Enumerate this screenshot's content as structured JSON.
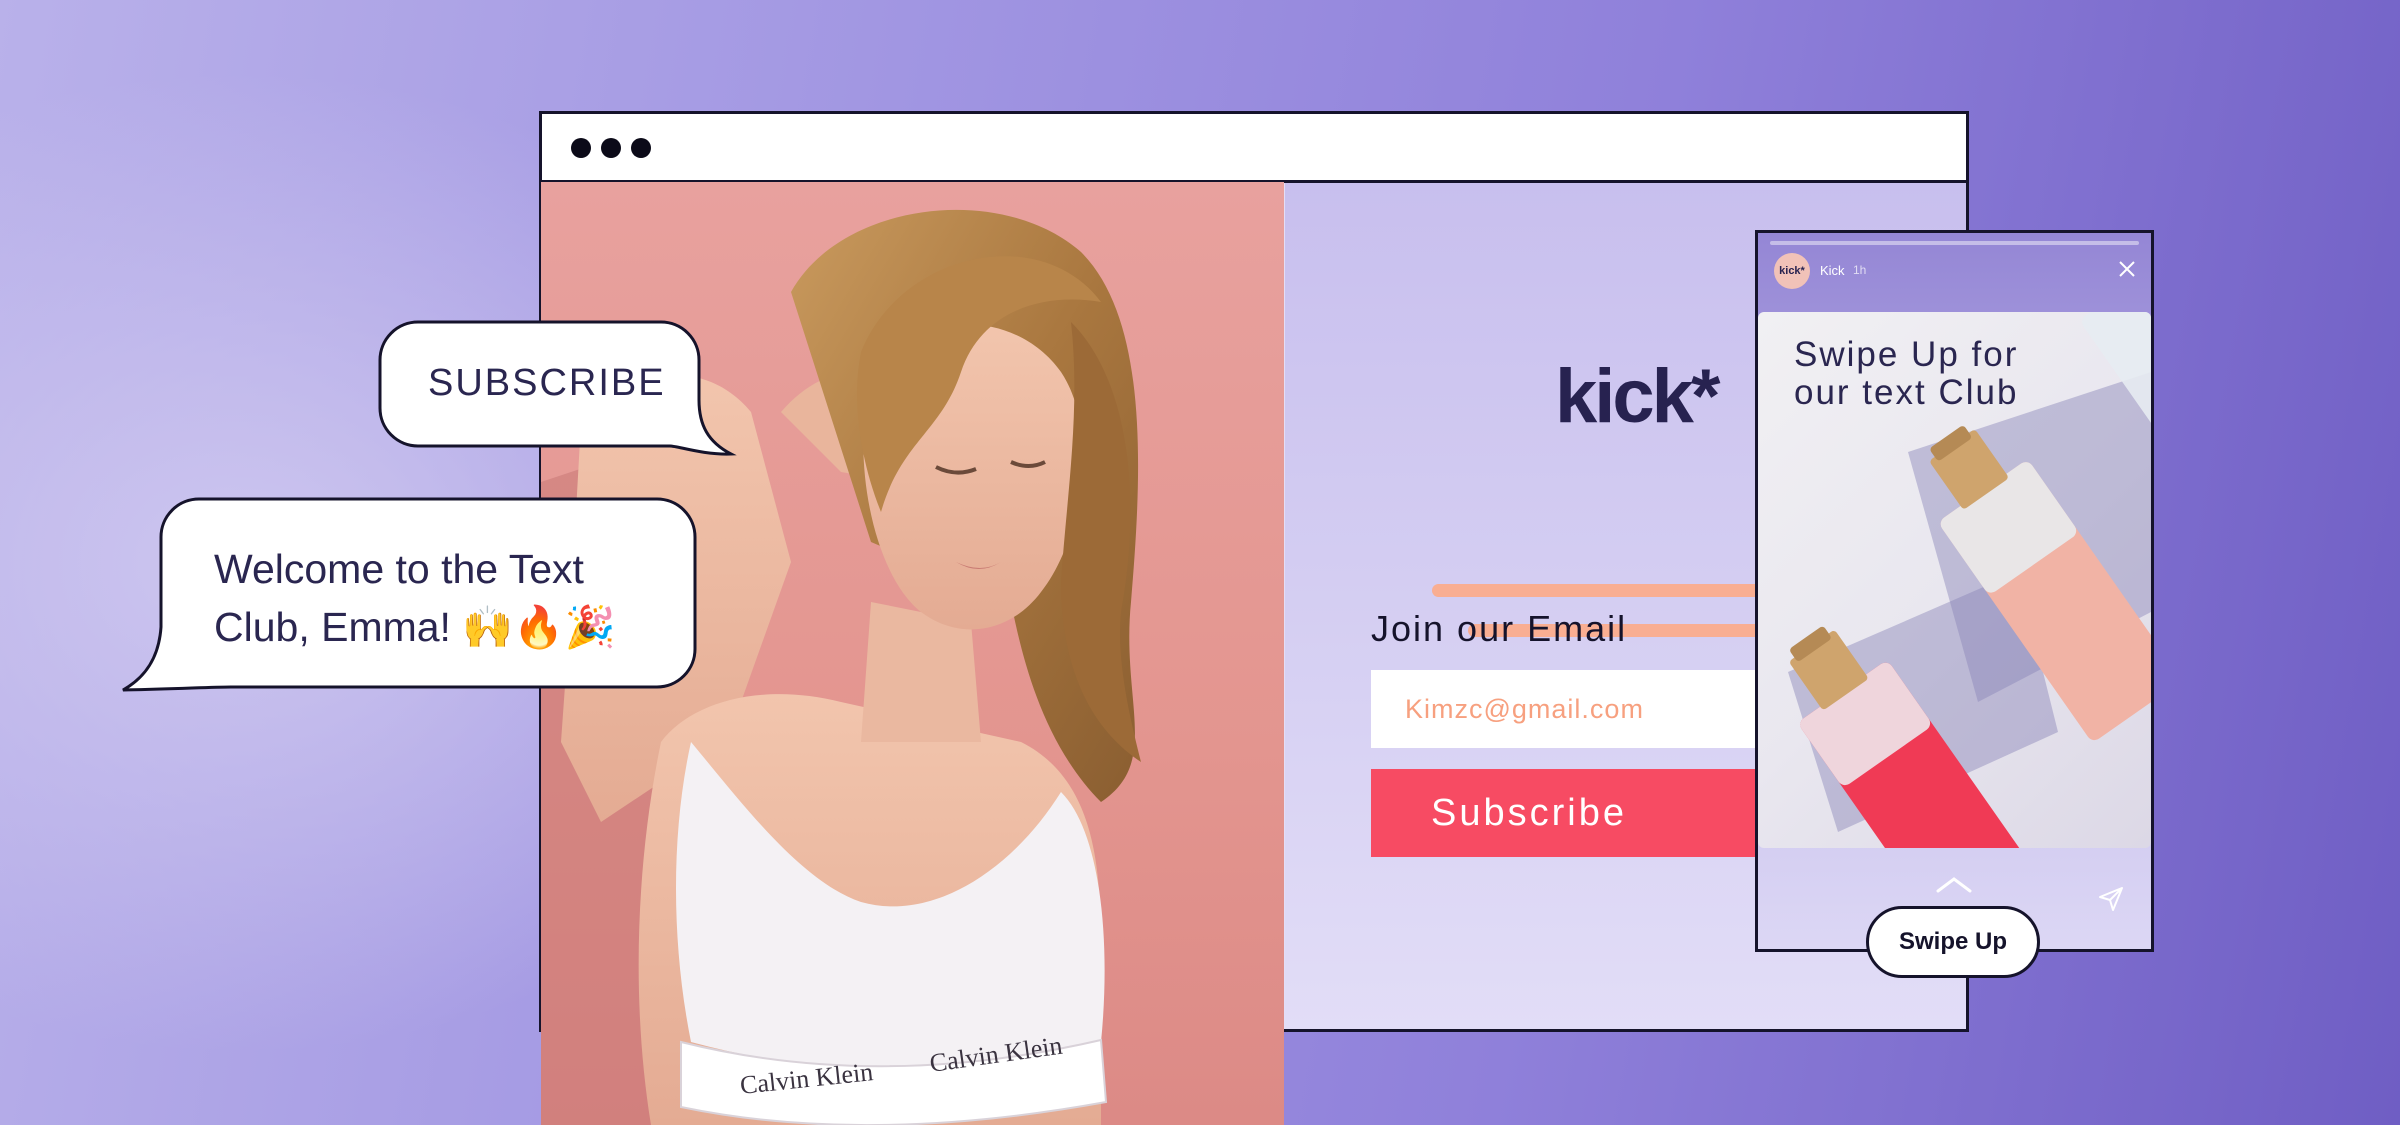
{
  "browser": {
    "brand_logo": "kick*",
    "join_title": "Join our Email",
    "email_value": "Kimzc@gmail.com",
    "subscribe_label": "Subscribe"
  },
  "story": {
    "avatar_text": "kick*",
    "username": "Kick",
    "time": "1h",
    "headline": "Swipe Up for our text Club",
    "swipe_up_label": "Swipe Up"
  },
  "bubbles": {
    "subscribe": "SUBSCRIBE",
    "welcome": "Welcome to the Text Club, Emma! 🙌🔥🎉"
  },
  "photo": {
    "brand_waistband": "Calvin Klein"
  },
  "colors": {
    "accent_coral": "#f74b63",
    "accent_peach": "#f9ae92",
    "ink": "#15132b",
    "brand_navy": "#272250"
  },
  "icons": [
    "window-dot-icon",
    "close-icon",
    "chevron-up-icon",
    "send-icon"
  ]
}
